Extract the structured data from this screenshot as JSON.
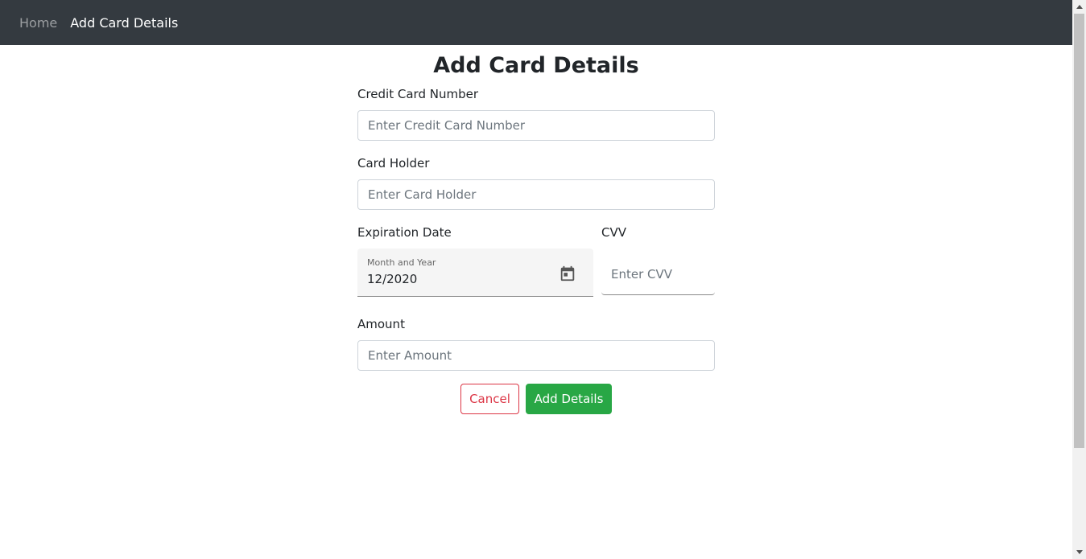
{
  "nav": {
    "home": "Home",
    "active": "Add Card Details"
  },
  "page": {
    "title": "Add Card Details"
  },
  "form": {
    "card_number": {
      "label": "Credit Card Number",
      "placeholder": "Enter Credit Card Number",
      "value": ""
    },
    "card_holder": {
      "label": "Card Holder",
      "placeholder": "Enter Card Holder",
      "value": ""
    },
    "expiration": {
      "label": "Expiration Date",
      "field_label": "Month and Year",
      "value": "12/2020",
      "icon": "calendar-icon"
    },
    "cvv": {
      "label": "CVV",
      "placeholder": "Enter CVV",
      "value": ""
    },
    "amount": {
      "label": "Amount",
      "placeholder": "Enter Amount",
      "value": ""
    }
  },
  "buttons": {
    "cancel": "Cancel",
    "add": "Add Details"
  },
  "colors": {
    "navbar": "#343a40",
    "cancel": "#dc3545",
    "add": "#28a745"
  }
}
